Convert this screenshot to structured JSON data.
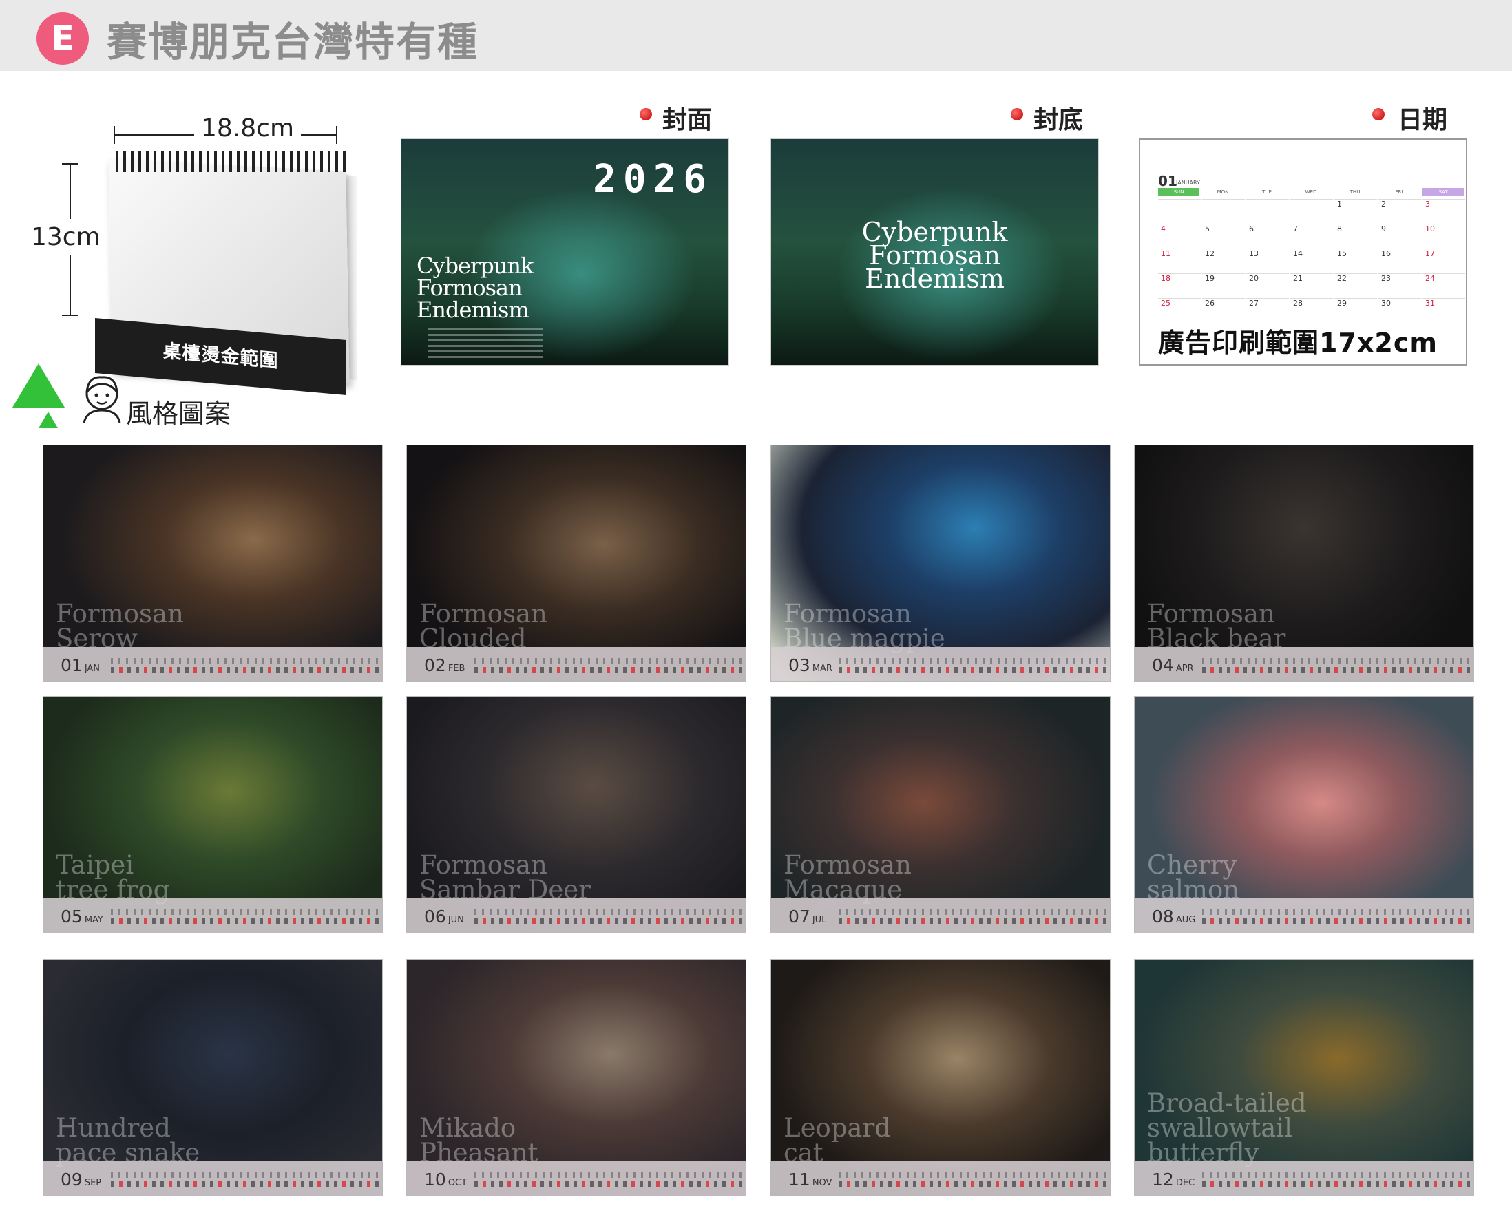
{
  "header": {
    "badge_letter": "E",
    "title": "賽博朋克台灣特有種"
  },
  "product": {
    "width_label": "18.8cm",
    "height_label": "13cm",
    "foil_label": "桌檯燙金範圍",
    "style_label": "風格圖案"
  },
  "previews": {
    "cover": {
      "label": "封面",
      "year": "2026",
      "title_lines": [
        "Cyberpunk",
        "Formosan",
        "Endemism"
      ]
    },
    "back": {
      "label": "封底",
      "title_lines": [
        "Cyberpunk",
        "Formosan",
        "Endemism"
      ]
    },
    "date": {
      "label": "日期",
      "month_number": "01",
      "month_name": "JANUARY",
      "weekdays": [
        "SUN",
        "MON",
        "TUE",
        "WED",
        "THU",
        "FRI",
        "SAT"
      ],
      "days": [
        [
          "",
          "",
          "",
          "",
          "1",
          "2",
          "3"
        ],
        [
          "4",
          "5",
          "6",
          "7",
          "8",
          "9",
          "10"
        ],
        [
          "11",
          "12",
          "13",
          "14",
          "15",
          "16",
          "17"
        ],
        [
          "18",
          "19",
          "20",
          "21",
          "22",
          "23",
          "24"
        ],
        [
          "25",
          "26",
          "27",
          "28",
          "29",
          "30",
          "31"
        ]
      ],
      "ad_text": "廣告印刷範圍17x2cm"
    }
  },
  "months": [
    {
      "num": "01",
      "abbr": "JAN",
      "title_lines": [
        "Formosan",
        "Serow"
      ]
    },
    {
      "num": "02",
      "abbr": "FEB",
      "title_lines": [
        "Formosan",
        "Clouded"
      ]
    },
    {
      "num": "03",
      "abbr": "MAR",
      "title_lines": [
        "Formosan",
        "Blue magpie"
      ]
    },
    {
      "num": "04",
      "abbr": "APR",
      "title_lines": [
        "Formosan",
        "Black bear"
      ]
    },
    {
      "num": "05",
      "abbr": "MAY",
      "title_lines": [
        "Taipei",
        "tree frog"
      ]
    },
    {
      "num": "06",
      "abbr": "JUN",
      "title_lines": [
        "Formosan",
        "Sambar Deer"
      ]
    },
    {
      "num": "07",
      "abbr": "JUL",
      "title_lines": [
        "Formosan",
        "Macaque"
      ]
    },
    {
      "num": "08",
      "abbr": "AUG",
      "title_lines": [
        "Cherry",
        "salmon"
      ]
    },
    {
      "num": "09",
      "abbr": "SEP",
      "title_lines": [
        "Hundred",
        "pace snake"
      ]
    },
    {
      "num": "10",
      "abbr": "OCT",
      "title_lines": [
        "Mikado",
        "Pheasant"
      ]
    },
    {
      "num": "11",
      "abbr": "NOV",
      "title_lines": [
        "Leopard",
        "cat"
      ]
    },
    {
      "num": "12",
      "abbr": "DEC",
      "title_lines": [
        "Broad-tailed",
        "swallowtail",
        "butterfly"
      ]
    }
  ],
  "colors": {
    "badge": "#ef5b7d",
    "accent_red": "#c00000",
    "style_triangle": "#33c13a"
  },
  "icons": [
    "red-dot-icon",
    "green-triangle-icon",
    "girl-face-icon"
  ]
}
